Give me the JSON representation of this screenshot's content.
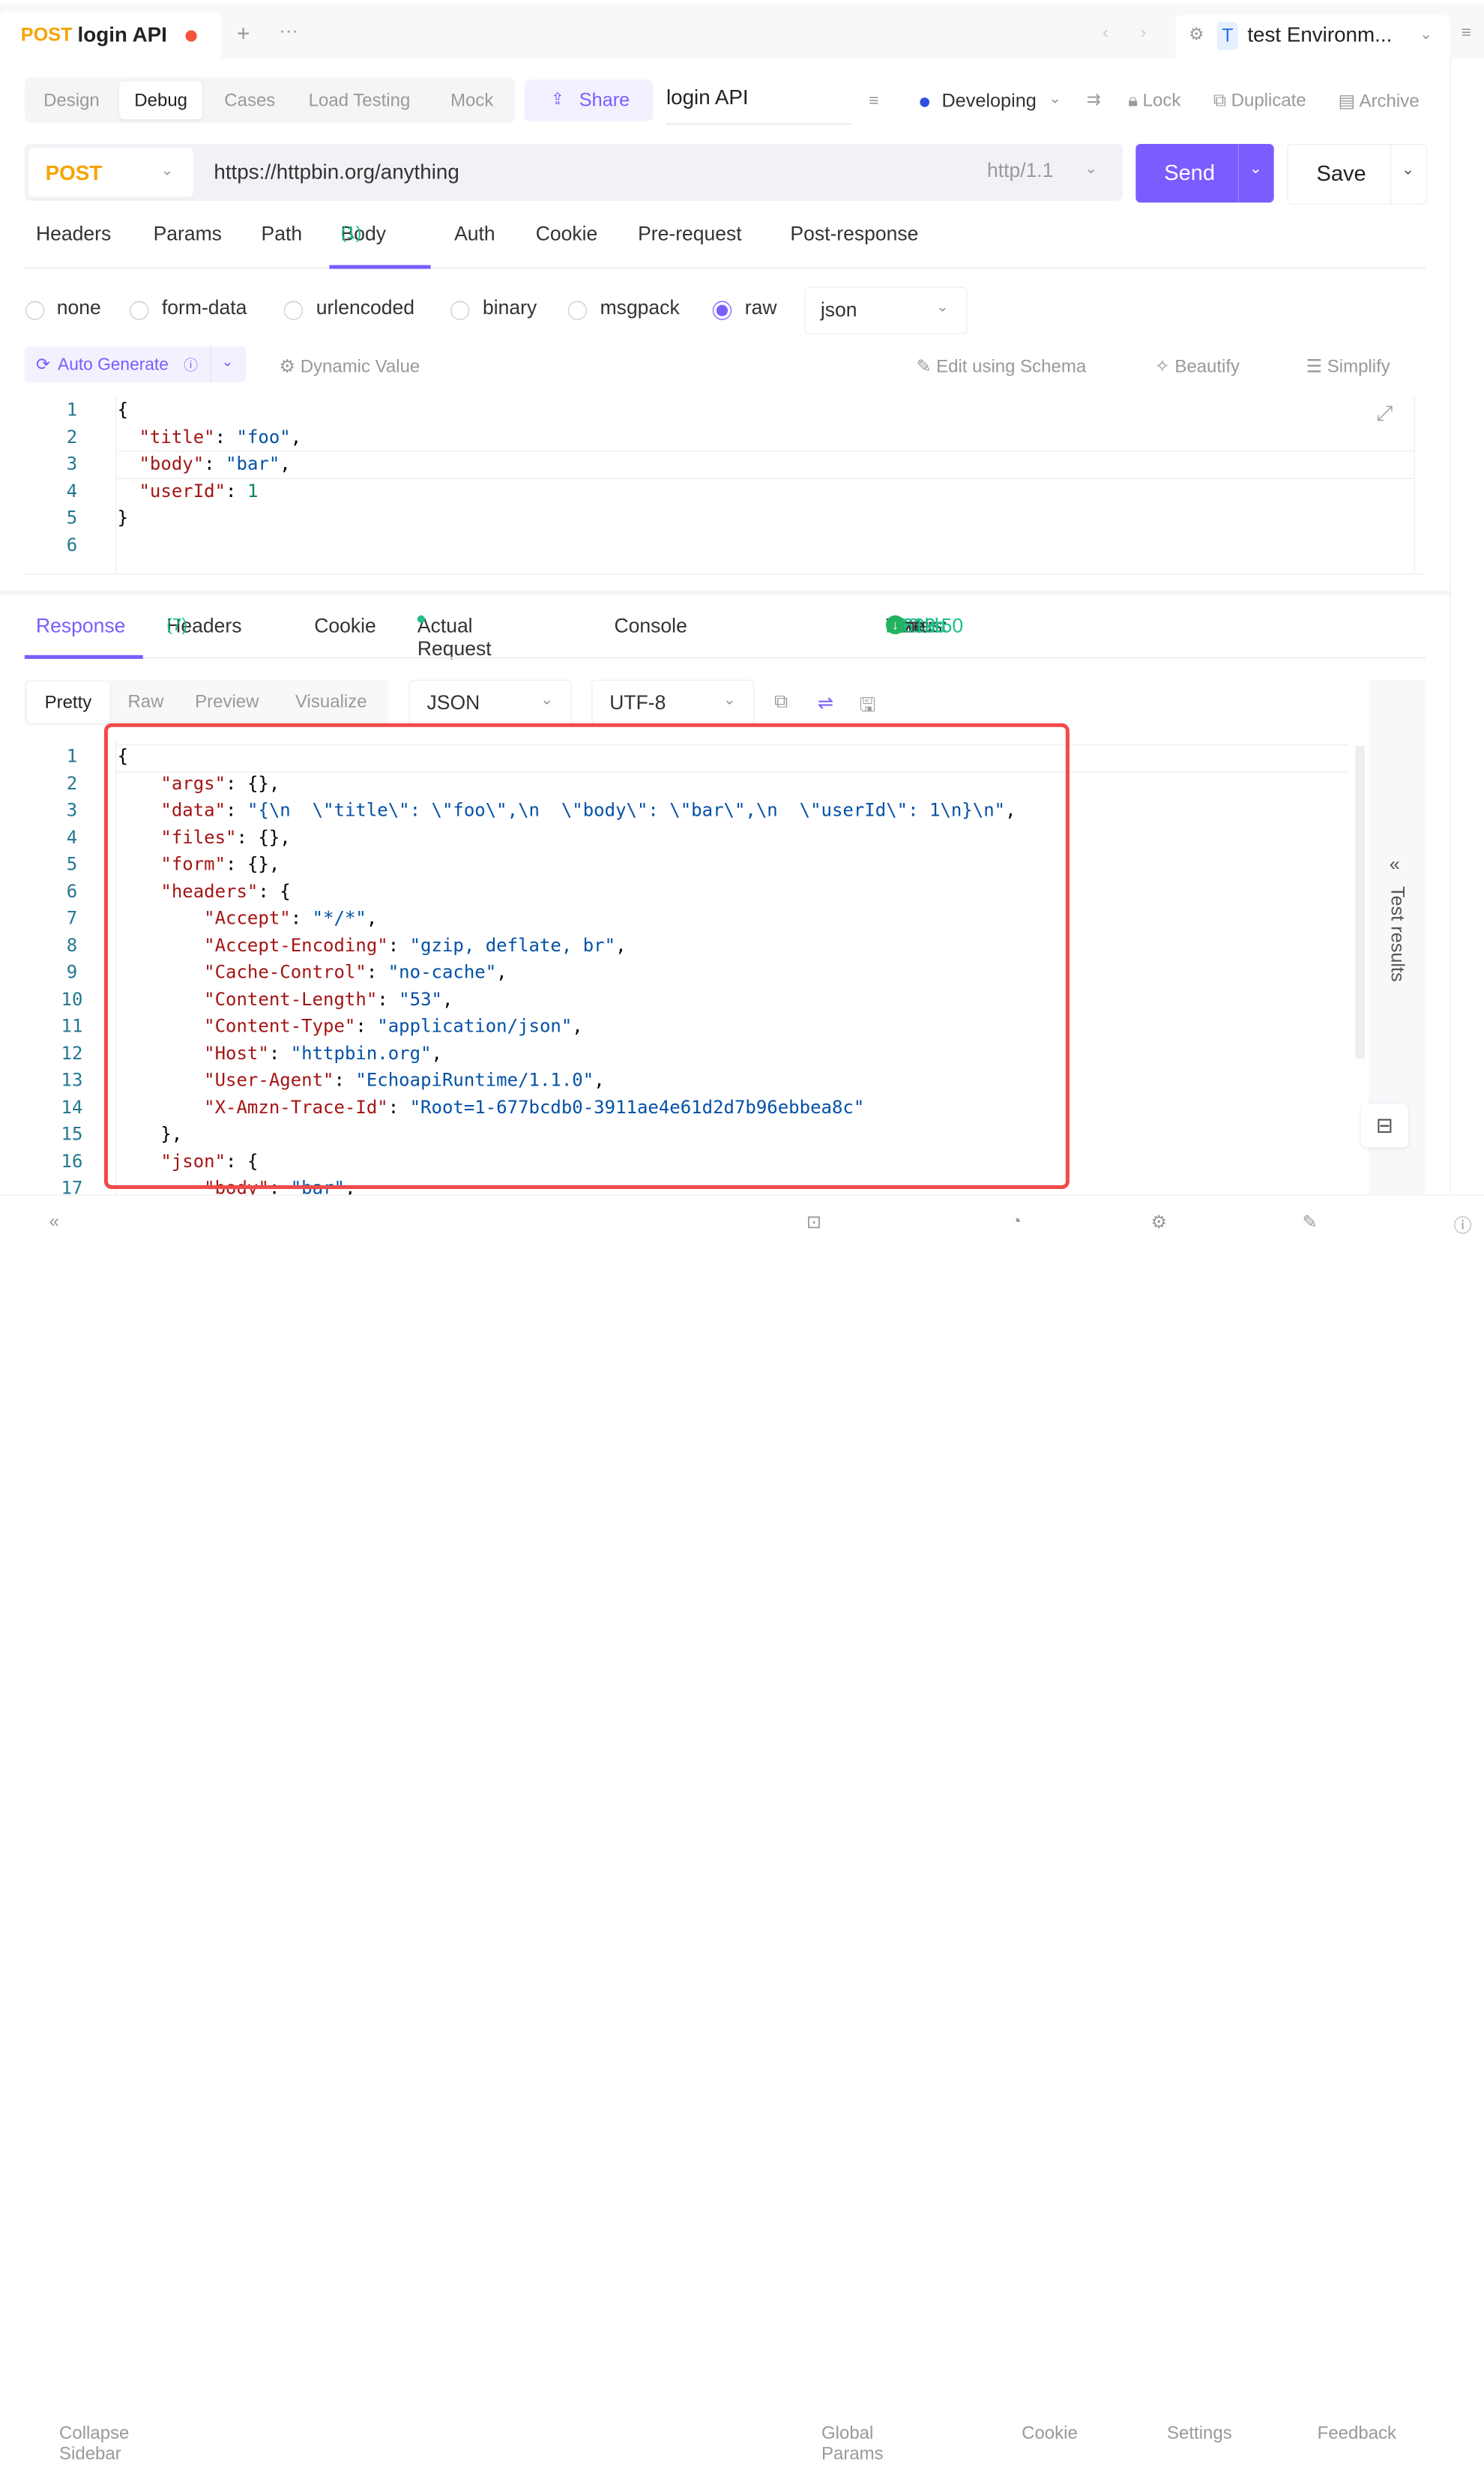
{
  "tab": {
    "method": "POST",
    "title": "login API",
    "unsaved_color": "#f5533d"
  },
  "env": {
    "badge": "T",
    "name": "test Environm..."
  },
  "modes": [
    "Design",
    "Debug",
    "Cases",
    "Load Testing",
    "Mock"
  ],
  "active_mode": "Debug",
  "share": "Share",
  "api_name": "login API",
  "status": "Developing",
  "actions": {
    "lock": "Lock",
    "duplicate": "Duplicate",
    "archive": "Archive"
  },
  "request": {
    "method": "POST",
    "url": "https://httpbin.org/anything",
    "protocol": "http/1.1",
    "send": "Send",
    "save": "Save"
  },
  "req_tabs": [
    {
      "label": "Headers"
    },
    {
      "label": "Params"
    },
    {
      "label": "Path"
    },
    {
      "label": "Body",
      "count": "(1)"
    },
    {
      "label": "Auth"
    },
    {
      "label": "Cookie"
    },
    {
      "label": "Pre-request"
    },
    {
      "label": "Post-response"
    }
  ],
  "body_types": [
    "none",
    "form-data",
    "urlencoded",
    "binary",
    "msgpack",
    "raw"
  ],
  "body_selected": "raw",
  "raw_format": "json",
  "body_tools": {
    "auto_generate": "Auto Generate",
    "dynamic": "Dynamic Value",
    "schema": "Edit using Schema",
    "beautify": "Beautify",
    "simplify": "Simplify"
  },
  "request_body": [
    "{",
    "  \"title\": \"foo\",",
    "  \"body\": \"bar\",",
    "  \"userId\": 1",
    "}",
    ""
  ],
  "resp_tabs": {
    "response": "Response",
    "headers": "Headers",
    "headers_count": "(7)",
    "cookie": "Cookie",
    "actual": "Actual Request",
    "console": "Console"
  },
  "resp_status": {
    "status_label": "Status:",
    "status": "200",
    "time_label": "Time:",
    "time": "20:33:50",
    "duration": "1.319s",
    "size_label": "Size:",
    "size": "0.61kb"
  },
  "view_modes": [
    "Pretty",
    "Raw",
    "Preview",
    "Visualize"
  ],
  "resp_format": "JSON",
  "encoding": "UTF-8",
  "test_results": "Test results",
  "response_body": [
    "{",
    "    \"args\": {},",
    "    \"data\": \"{\\n  \\\"title\\\": \\\"foo\\\",\\n  \\\"body\\\": \\\"bar\\\",\\n  \\\"userId\\\": 1\\n}\\n\",",
    "    \"files\": {},",
    "    \"form\": {},",
    "    \"headers\": {",
    "        \"Accept\": \"*/*\",",
    "        \"Accept-Encoding\": \"gzip, deflate, br\",",
    "        \"Cache-Control\": \"no-cache\",",
    "        \"Content-Length\": \"53\",",
    "        \"Content-Type\": \"application/json\",",
    "        \"Host\": \"httpbin.org\",",
    "        \"User-Agent\": \"EchoapiRuntime/1.1.0\",",
    "        \"X-Amzn-Trace-Id\": \"Root=1-677bcdb0-3911ae4e61d2d7b96ebbea8c\"",
    "    },",
    "    \"json\": {",
    "        \"body\": \"bar\","
  ],
  "footer": {
    "collapse": "Collapse Sidebar",
    "global": "Global Params",
    "cookie": "Cookie",
    "settings": "Settings",
    "feedback": "Feedback"
  },
  "colors": {
    "accent": "#7b5cff",
    "success": "#1dbf8a",
    "method": "#f5a300",
    "highlight": "#f24a4a"
  }
}
